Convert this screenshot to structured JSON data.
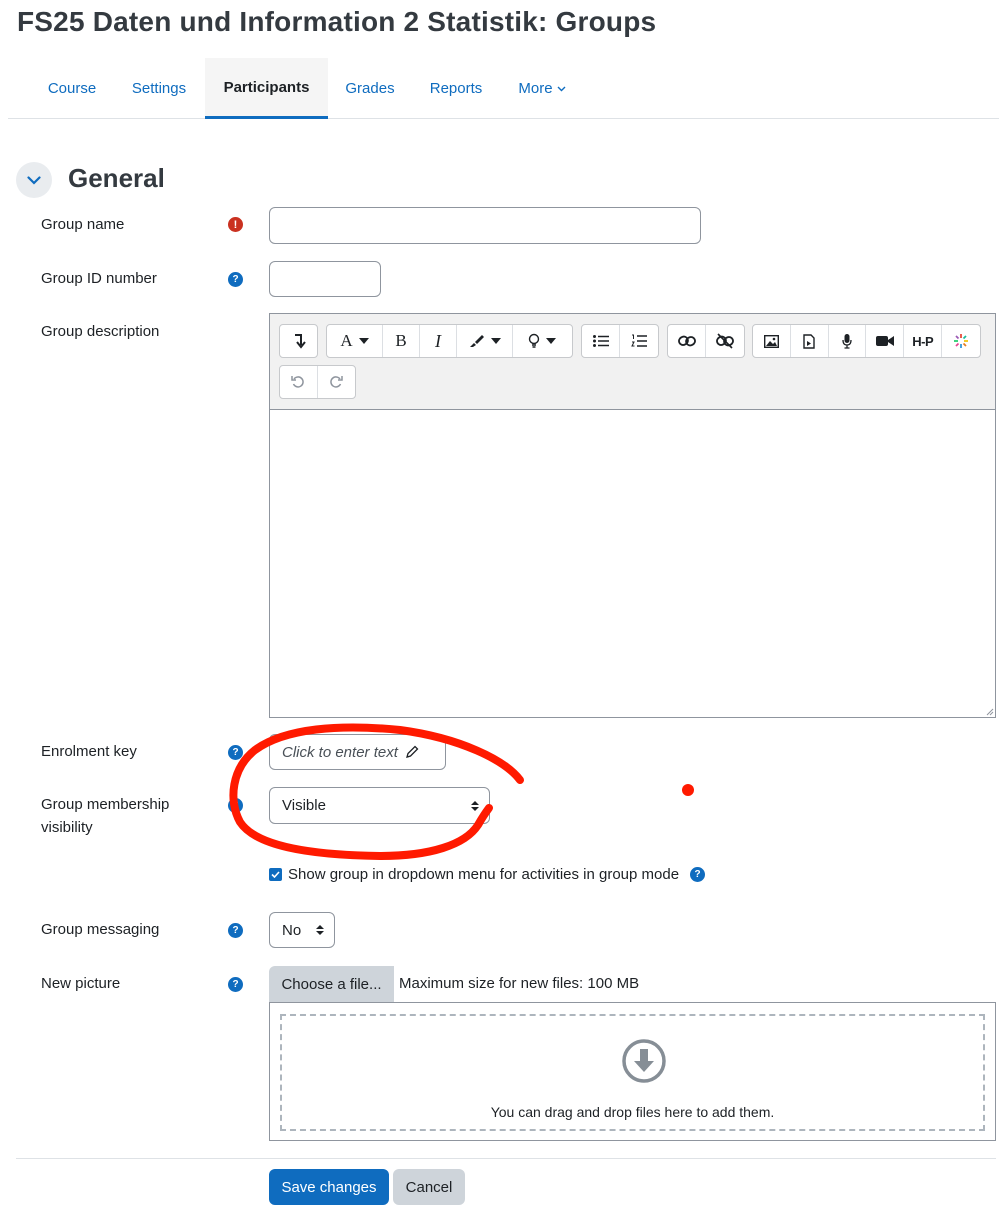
{
  "page": {
    "title": "FS25 Daten und Information 2 Statistik: Groups"
  },
  "tabs": [
    {
      "label": "Course"
    },
    {
      "label": "Settings"
    },
    {
      "label": "Participants",
      "active": true
    },
    {
      "label": "Grades"
    },
    {
      "label": "Reports"
    },
    {
      "label": "More"
    }
  ],
  "section": {
    "title": "General"
  },
  "fields": {
    "group_name": {
      "label": "Group name",
      "value": ""
    },
    "group_id": {
      "label": "Group ID number",
      "value": ""
    },
    "group_description": {
      "label": "Group description",
      "value": ""
    },
    "enrolment_key": {
      "label": "Enrolment key",
      "placeholder": "Click to enter text"
    },
    "membership_visibility": {
      "label_line1": "Group membership",
      "label_line2": "visibility",
      "selected": "Visible"
    },
    "show_in_dropdown": {
      "label": "Show group in dropdown menu for activities in group mode",
      "checked": true
    },
    "group_messaging": {
      "label": "Group messaging",
      "selected": "No"
    },
    "new_picture": {
      "label": "New picture",
      "choose_button": "Choose a file...",
      "max_size": "Maximum size for new files: 100 MB",
      "drop_text": "You can drag and drop files here to add them."
    }
  },
  "editor_toolbar": {
    "icons": [
      "collapse-icon",
      "font-color-icon",
      "bold-icon",
      "italic-icon",
      "highlight-icon",
      "tips-icon",
      "bullet-list-icon",
      "numbered-list-icon",
      "link-icon",
      "unlink-icon",
      "image-icon",
      "media-icon",
      "microphone-icon",
      "video-icon",
      "h5p-icon",
      "spinner-icon",
      "undo-icon",
      "redo-icon"
    ],
    "h5p_label": "H-P",
    "bold_glyph": "B",
    "italic_glyph": "I",
    "font_glyph": "A"
  },
  "actions": {
    "save": "Save changes",
    "cancel": "Cancel"
  },
  "colors": {
    "brand": "#0f6cbf",
    "required": "#ca3120",
    "annotation": "#ff1a00"
  }
}
